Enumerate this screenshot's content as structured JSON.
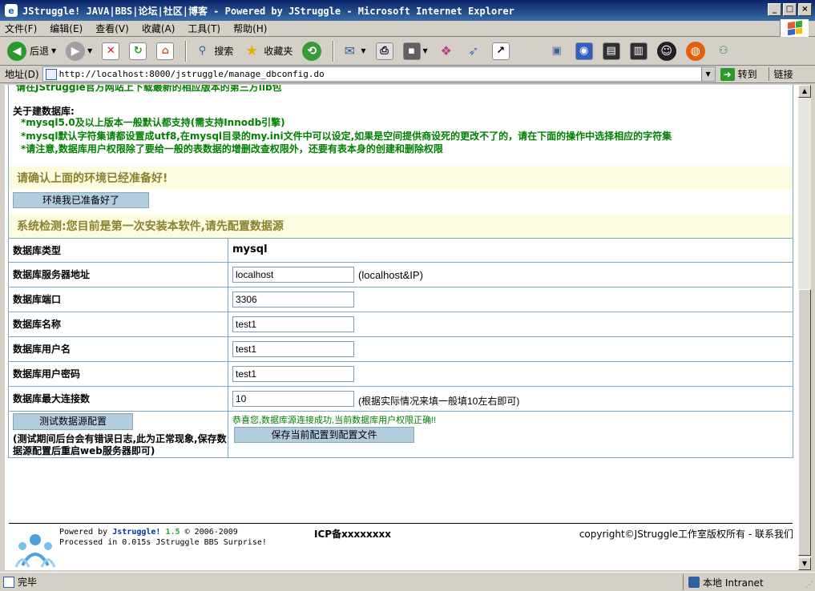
{
  "window": {
    "title": "JStruggle! JAVA|BBS|论坛|社区|博客 - Powered by JStruggle - Microsoft Internet Explorer",
    "minimize": "_",
    "maximize": "□",
    "close": "×"
  },
  "menu": [
    "文件(F)",
    "编辑(E)",
    "查看(V)",
    "收藏(A)",
    "工具(T)",
    "帮助(H)"
  ],
  "toolbar": {
    "back_label": "后退",
    "search_label": "搜索",
    "favorites_label": "收藏夹"
  },
  "address": {
    "label": "地址(D)",
    "url": "http://localhost:8000/jstruggle/manage_dbconfig.do",
    "go_label": "转到",
    "links_label": "链接"
  },
  "content": {
    "cut_line": "请在JStruggle官方网站上下载最新的相应版本的第三方lib包",
    "db_title": "关于建数据库:",
    "db_notes": [
      "*mysql5.0及以上版本一般默认都支持(需支持Innodb引擎)",
      "*mysql默认字符集请都设置成utf8,在mysql目录的my.ini文件中可以设定,如果是空间提供商设死的更改不了的，请在下面的操作中选择相应的字符集",
      "*请注意,数据库用户权限除了要给一般的表数据的增删改查权限外，还要有表本身的创建和删除权限"
    ],
    "confirm_env": "请确认上面的环境已经准备好!",
    "ready_button": "环境我已准备好了",
    "system_check": "系统检测:您目前是第一次安装本软件,请先配置数据源",
    "form": {
      "db_type_label": "数据库类型",
      "db_type_value": "mysql",
      "server_label": "数据库服务器地址",
      "server_value": "localhost",
      "server_hint": "(localhost&IP)",
      "port_label": "数据库端口",
      "port_value": "3306",
      "name_label": "数据库名称",
      "name_value": "test1",
      "user_label": "数据库用户名",
      "user_value": "test1",
      "password_label": "数据库用户密码",
      "password_value": "test1",
      "maxconn_label": "数据库最大连接数",
      "maxconn_value": "10",
      "maxconn_hint": "(根据实际情况来填一般填10左右即可)"
    },
    "test_button": "测试数据源配置",
    "test_note": "(测试期间后台会有错误日志,此为正常现象,保存数据源配置后重启web服务器即可)",
    "success_msg": "恭喜您,数据库源连接成功,当前数据库用户权限正确!!",
    "save_button": "保存当前配置到配置文件"
  },
  "footer": {
    "powered_prefix": "Powered by",
    "brand": "Jstruggle!",
    "version": "1.5",
    "years": "© 2006-2009",
    "processed": "Processed in 0.015s JStruggle BBS Surprise!",
    "icp": "ICP备xxxxxxxx",
    "copyright": "copyright©JStruggle工作室版权所有 - 联系我们"
  },
  "status": {
    "done": "完毕",
    "zone": "本地 Intranet"
  }
}
